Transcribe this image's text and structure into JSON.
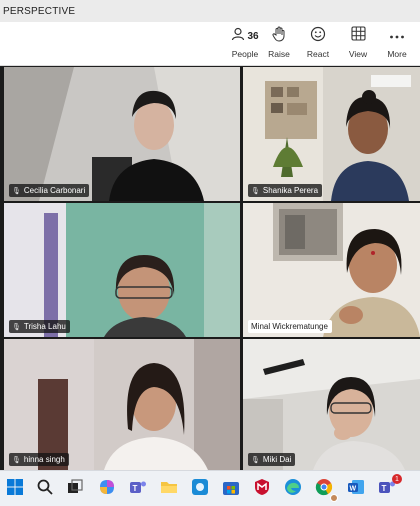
{
  "window": {
    "title": "PERSPECTIVE"
  },
  "toolbar": {
    "people_count": "36",
    "people_label": "People",
    "raise_label": "Raise",
    "react_label": "React",
    "view_label": "View",
    "more_label": "More"
  },
  "participants": [
    {
      "name": "Cecilia Carbonari"
    },
    {
      "name": "Shanika Perera"
    },
    {
      "name": "Trisha Lahu"
    },
    {
      "name": "Minal Wickrematunge"
    },
    {
      "name": "hinna singh"
    },
    {
      "name": "Miki Dai"
    }
  ],
  "taskbar": {
    "teams_badge": "1"
  },
  "colors": {
    "accent": "#5b5fc7",
    "toolbar_bg": "#ffffff",
    "taskbar_bg": "#eef1f5"
  }
}
